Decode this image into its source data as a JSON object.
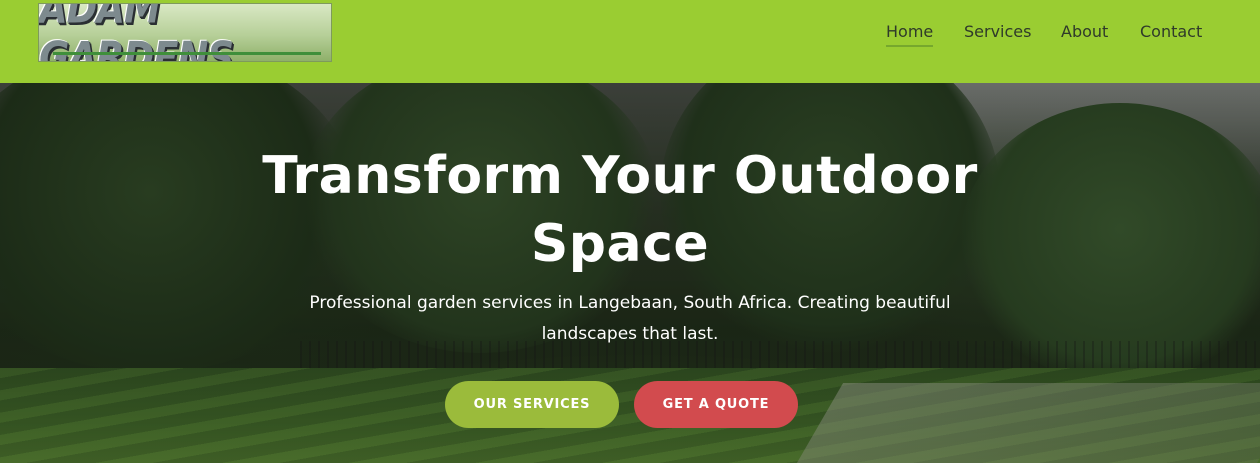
{
  "brand": {
    "logo_text": "ADAM GARDENS",
    "color_header": "#9acd32",
    "color_primary_button": "#9bbb3b",
    "color_secondary_button": "#d24b4e"
  },
  "nav": {
    "items": [
      {
        "label": "Home",
        "active": true
      },
      {
        "label": "Services",
        "active": false
      },
      {
        "label": "About",
        "active": false
      },
      {
        "label": "Contact",
        "active": false
      }
    ]
  },
  "hero": {
    "title_line1": "Transform Your Outdoor",
    "title_line2": "Space",
    "subtitle_line1": "Professional garden services in Langebaan, South Africa. Creating beautiful",
    "subtitle_line2": "landscapes that last.",
    "primary_button": "OUR SERVICES",
    "secondary_button": "GET A QUOTE"
  }
}
